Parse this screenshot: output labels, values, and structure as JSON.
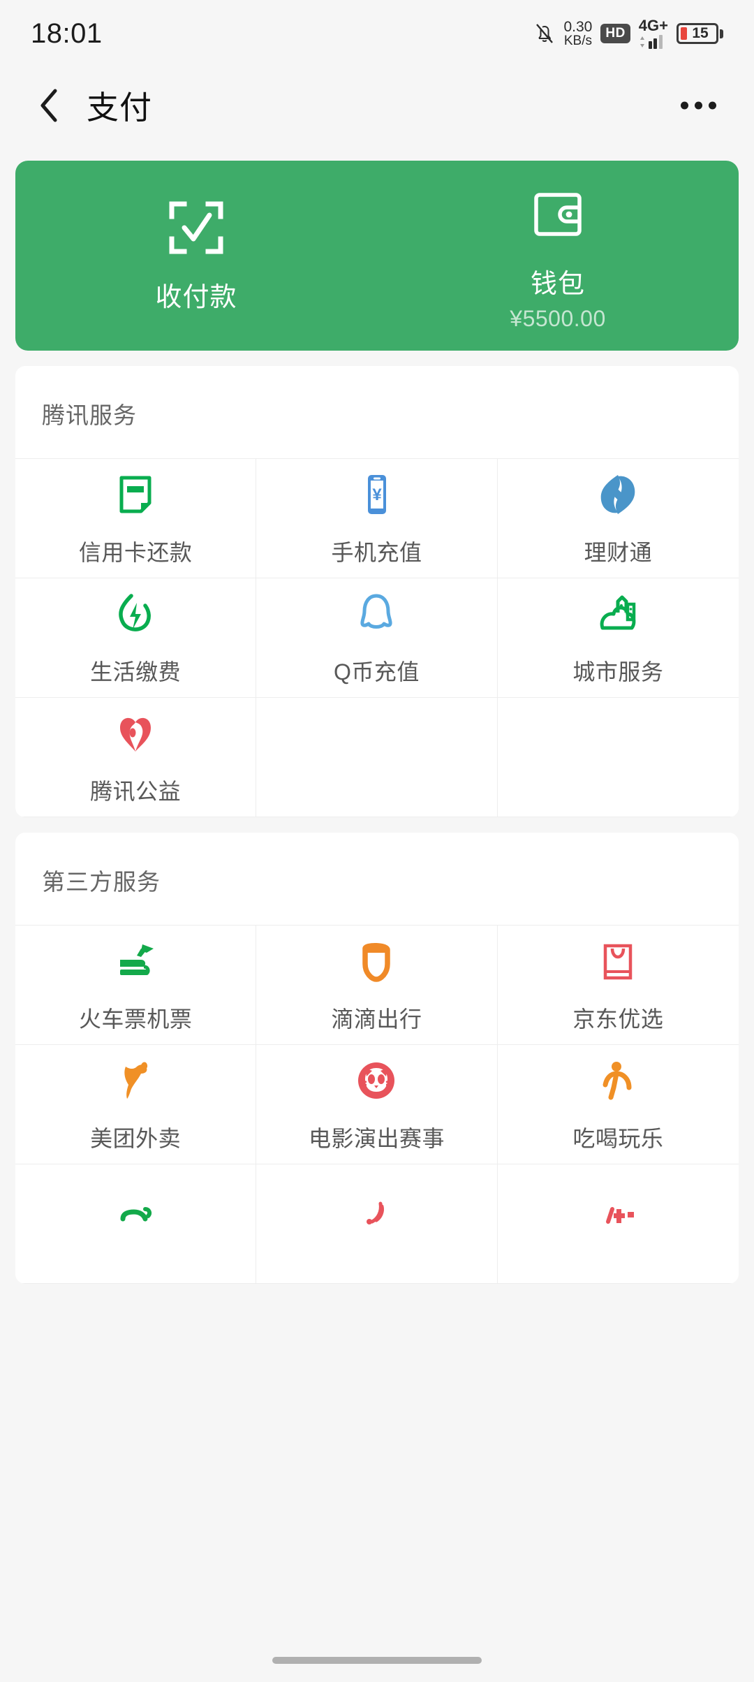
{
  "status_bar": {
    "time": "18:01",
    "net_speed_value": "0.30",
    "net_speed_unit": "KB/s",
    "hd_badge": "HD",
    "network": "4G+",
    "battery_percent": "15",
    "mute_icon": "bell-muted-icon"
  },
  "nav": {
    "back_icon": "chevron-left-icon",
    "title": "支付",
    "more_icon": "more-options-icon"
  },
  "hero_card": {
    "background_color": "#3eac69",
    "actions": [
      {
        "icon": "scan-pay-icon",
        "label": "收付款",
        "sub": ""
      },
      {
        "icon": "wallet-icon",
        "label": "钱包",
        "sub": "¥5500.00"
      }
    ]
  },
  "sections": [
    {
      "title": "腾讯服务",
      "items": [
        {
          "label": "信用卡还款",
          "icon": "credit-card-repay-icon",
          "color": "#09ad4f"
        },
        {
          "label": "手机充值",
          "icon": "mobile-topup-icon",
          "color": "#4a90d9"
        },
        {
          "label": "理财通",
          "icon": "licaitong-icon",
          "color": "#4a95c9"
        },
        {
          "label": "生活缴费",
          "icon": "utility-bill-icon",
          "color": "#09ad4f"
        },
        {
          "label": "Q币充值",
          "icon": "qq-coin-icon",
          "color": "#5aa9e0"
        },
        {
          "label": "城市服务",
          "icon": "city-service-icon",
          "color": "#09ad4f"
        },
        {
          "label": "腾讯公益",
          "icon": "charity-heart-icon",
          "color": "#e8535b"
        }
      ]
    },
    {
      "title": "第三方服务",
      "items": [
        {
          "label": "火车票机票",
          "icon": "train-plane-icon",
          "color": "#13a94a"
        },
        {
          "label": "滴滴出行",
          "icon": "didi-icon",
          "color": "#f08a28"
        },
        {
          "label": "京东优选",
          "icon": "jd-bag-icon",
          "color": "#e8535b"
        },
        {
          "label": "美团外卖",
          "icon": "meituan-kangaroo-icon",
          "color": "#f09026"
        },
        {
          "label": "电影演出赛事",
          "icon": "maoyan-cat-icon",
          "color": "#e8535b"
        },
        {
          "label": "吃喝玩乐",
          "icon": "dianping-person-icon",
          "color": "#f09026"
        },
        {
          "label": "",
          "icon": "car-green-icon",
          "color": "#13a94a"
        },
        {
          "label": "",
          "icon": "signal-red-icon",
          "color": "#e8535b"
        },
        {
          "label": "",
          "icon": "medical-cross-icon",
          "color": "#e8535b"
        }
      ]
    }
  ]
}
